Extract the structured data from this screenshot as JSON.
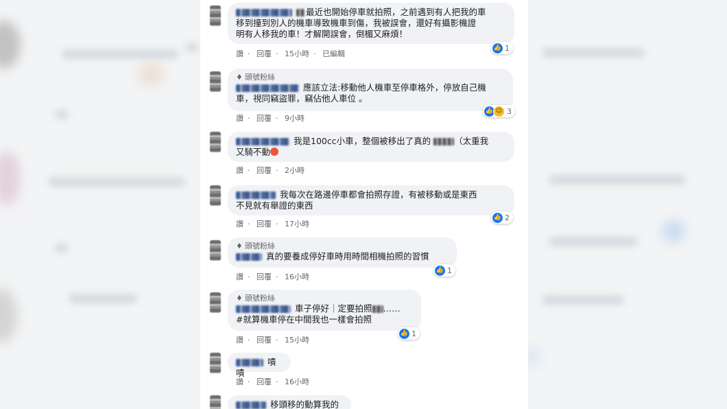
{
  "comments": [
    {
      "text": "最近也開始停車就拍照，之前遇到有人把我的車\n移到撞到別人的機車導致機車到傷，我被誤會，還好有攝影機證\n明有人移我的車！才解開誤會，倒楣又麻煩！",
      "actions": [
        "讚",
        "回覆",
        "15小時",
        "已編輯"
      ],
      "reaction_count": "1"
    },
    {
      "badge": "頭號粉絲",
      "text": "應該立法:移動他人機車至停車格外，停放自己機\n車，視同竊盜罪，竊佔他人車位 。",
      "actions": [
        "讚",
        "回覆",
        "9小時"
      ],
      "reaction_count": "3"
    },
    {
      "text_a": "我是100cc小車，整個被移出了真的",
      "text_b": "（太重我\n又騎不動",
      "actions": [
        "讚",
        "回覆",
        "2小時"
      ]
    },
    {
      "text": "我每次在路邊停車都會拍照存證，有被移動或是東西\n不見就有舉證的東西",
      "actions": [
        "讚",
        "回覆",
        "17小時"
      ],
      "reaction_count": "2"
    },
    {
      "badge": "頭號粉絲",
      "text": "真的要養成停好車時用時間相機拍照的習慣",
      "actions": [
        "讚",
        "回覆",
        "16小時"
      ],
      "reaction_count": "1"
    },
    {
      "badge": "頭號粉絲",
      "text_a": "車子停好｜定要拍照",
      "text_b": "……\n#就算機車停在中間我也一樣會拍照",
      "actions": [
        "讚",
        "回覆",
        "15小時"
      ],
      "reaction_count": "1"
    },
    {
      "text": "嘖嘖",
      "actions": [
        "讚",
        "回覆",
        "16小時"
      ]
    },
    {
      "text": "移頭移的動算我的"
    }
  ],
  "colors": {
    "like": "#1877f2",
    "bubble": "#f0f2f5",
    "meta": "#65676b"
  },
  "icons": {
    "like": "like-icon",
    "haha": "haha-icon",
    "badge": "diamond-icon"
  }
}
